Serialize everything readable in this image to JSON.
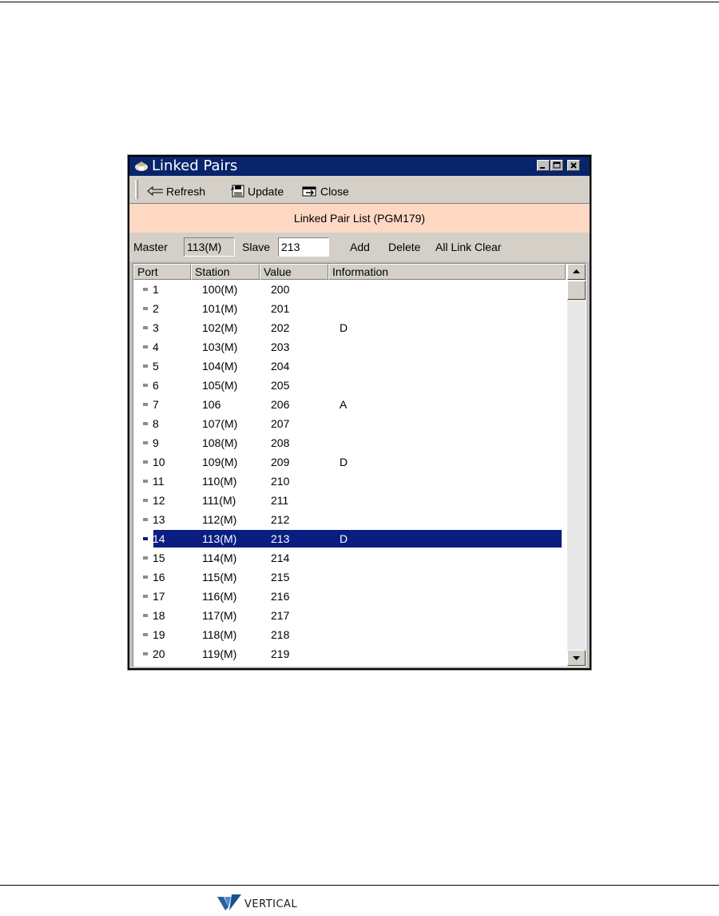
{
  "window": {
    "title": "Linked Pairs"
  },
  "toolbar": {
    "refresh_label": "Refresh",
    "update_label": "Update",
    "close_label": "Close"
  },
  "banner": {
    "text": "Linked Pair List (PGM179)"
  },
  "controls": {
    "master_label": "Master",
    "master_value": "113(M)",
    "slave_label": "Slave",
    "slave_value": "213",
    "add_label": "Add",
    "delete_label": "Delete",
    "clear_label": "All Link Clear"
  },
  "table": {
    "columns": [
      "Port",
      "Station",
      "Value",
      "Information"
    ],
    "rows": [
      {
        "port": "1",
        "station": "100(M)",
        "value": "200",
        "info": ""
      },
      {
        "port": "2",
        "station": "101(M)",
        "value": "201",
        "info": ""
      },
      {
        "port": "3",
        "station": "102(M)",
        "value": "202",
        "info": "D"
      },
      {
        "port": "4",
        "station": "103(M)",
        "value": "203",
        "info": ""
      },
      {
        "port": "5",
        "station": "104(M)",
        "value": "204",
        "info": ""
      },
      {
        "port": "6",
        "station": "105(M)",
        "value": "205",
        "info": ""
      },
      {
        "port": "7",
        "station": "106",
        "value": "206",
        "info": "A"
      },
      {
        "port": "8",
        "station": "107(M)",
        "value": "207",
        "info": ""
      },
      {
        "port": "9",
        "station": "108(M)",
        "value": "208",
        "info": ""
      },
      {
        "port": "10",
        "station": "109(M)",
        "value": "209",
        "info": "D"
      },
      {
        "port": "11",
        "station": "110(M)",
        "value": "210",
        "info": ""
      },
      {
        "port": "12",
        "station": "111(M)",
        "value": "211",
        "info": ""
      },
      {
        "port": "13",
        "station": "112(M)",
        "value": "212",
        "info": ""
      },
      {
        "port": "14",
        "station": "113(M)",
        "value": "213",
        "info": "D",
        "selected": true
      },
      {
        "port": "15",
        "station": "114(M)",
        "value": "214",
        "info": ""
      },
      {
        "port": "16",
        "station": "115(M)",
        "value": "215",
        "info": ""
      },
      {
        "port": "17",
        "station": "116(M)",
        "value": "216",
        "info": ""
      },
      {
        "port": "18",
        "station": "117(M)",
        "value": "217",
        "info": ""
      },
      {
        "port": "19",
        "station": "118(M)",
        "value": "218",
        "info": ""
      },
      {
        "port": "20",
        "station": "119(M)",
        "value": "219",
        "info": ""
      }
    ]
  },
  "footer": {
    "logo_text": "VERTICAL"
  },
  "colors": {
    "titlebar": "#08246b",
    "banner": "#ffd8c4",
    "selection": "#0a1e82"
  }
}
